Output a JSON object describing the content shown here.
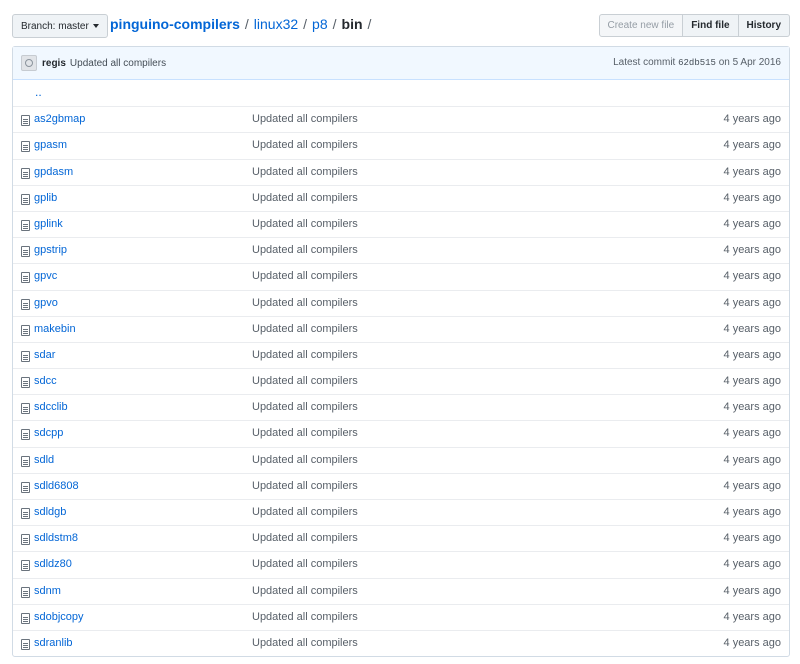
{
  "toolbar": {
    "branch_label": "Branch: master",
    "breadcrumb": {
      "repo": "pinguino-compilers",
      "path": [
        "linux32",
        "p8"
      ],
      "current": "bin",
      "separator": "/"
    },
    "buttons": {
      "create_new_file": "Create new file",
      "find_file": "Find file",
      "history": "History"
    }
  },
  "commit": {
    "author": "regis",
    "message": "Updated all compilers",
    "latest_label": "Latest commit",
    "sha": "62db515",
    "date": "on 5 Apr 2016"
  },
  "parent_link": "..",
  "files": [
    {
      "name": "as2gbmap",
      "message": "Updated all compilers",
      "age": "4 years ago"
    },
    {
      "name": "gpasm",
      "message": "Updated all compilers",
      "age": "4 years ago"
    },
    {
      "name": "gpdasm",
      "message": "Updated all compilers",
      "age": "4 years ago"
    },
    {
      "name": "gplib",
      "message": "Updated all compilers",
      "age": "4 years ago"
    },
    {
      "name": "gplink",
      "message": "Updated all compilers",
      "age": "4 years ago"
    },
    {
      "name": "gpstrip",
      "message": "Updated all compilers",
      "age": "4 years ago"
    },
    {
      "name": "gpvc",
      "message": "Updated all compilers",
      "age": "4 years ago"
    },
    {
      "name": "gpvo",
      "message": "Updated all compilers",
      "age": "4 years ago"
    },
    {
      "name": "makebin",
      "message": "Updated all compilers",
      "age": "4 years ago"
    },
    {
      "name": "sdar",
      "message": "Updated all compilers",
      "age": "4 years ago"
    },
    {
      "name": "sdcc",
      "message": "Updated all compilers",
      "age": "4 years ago"
    },
    {
      "name": "sdcclib",
      "message": "Updated all compilers",
      "age": "4 years ago"
    },
    {
      "name": "sdcpp",
      "message": "Updated all compilers",
      "age": "4 years ago"
    },
    {
      "name": "sdld",
      "message": "Updated all compilers",
      "age": "4 years ago"
    },
    {
      "name": "sdld6808",
      "message": "Updated all compilers",
      "age": "4 years ago"
    },
    {
      "name": "sdldgb",
      "message": "Updated all compilers",
      "age": "4 years ago"
    },
    {
      "name": "sdldstm8",
      "message": "Updated all compilers",
      "age": "4 years ago"
    },
    {
      "name": "sdldz80",
      "message": "Updated all compilers",
      "age": "4 years ago"
    },
    {
      "name": "sdnm",
      "message": "Updated all compilers",
      "age": "4 years ago"
    },
    {
      "name": "sdobjcopy",
      "message": "Updated all compilers",
      "age": "4 years ago"
    },
    {
      "name": "sdranlib",
      "message": "Updated all compilers",
      "age": "4 years ago"
    }
  ]
}
